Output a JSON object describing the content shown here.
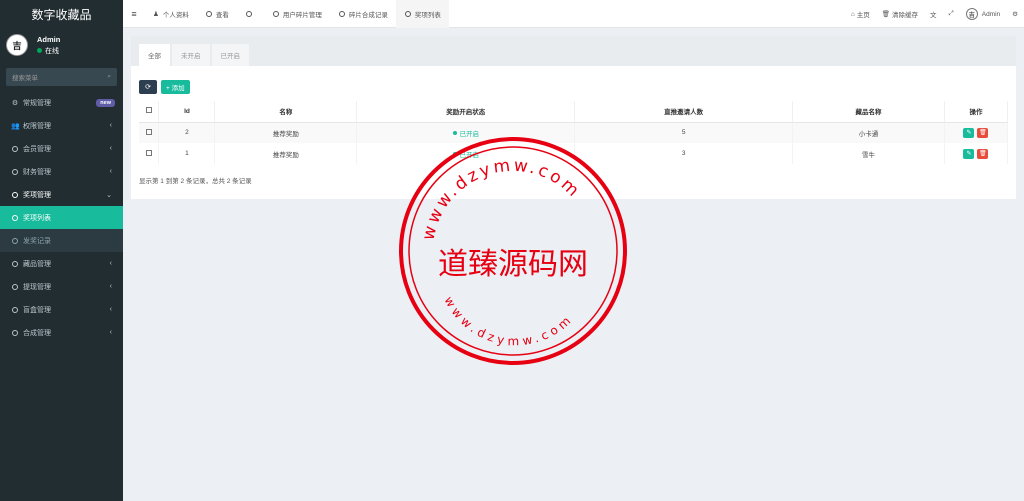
{
  "brand": "数字收藏品",
  "user": {
    "name": "Admin",
    "status": "在线",
    "avatar_glyph": "吉祥"
  },
  "search": {
    "placeholder": "搜索菜单"
  },
  "sidebar": {
    "items": [
      {
        "label": "常规管理",
        "icon": "gears-icon",
        "badge": "new"
      },
      {
        "label": "权限管理",
        "icon": "users-icon",
        "chevron": "‹"
      },
      {
        "label": "会员管理",
        "icon": "circle-icon",
        "chevron": "‹"
      },
      {
        "label": "财务管理",
        "icon": "circle-icon",
        "chevron": "‹"
      },
      {
        "label": "奖项管理",
        "icon": "circle-icon",
        "chevron": "⌄"
      },
      {
        "label": "奖项列表",
        "icon": "circle-icon"
      },
      {
        "label": "发奖记录",
        "icon": "circle-icon"
      },
      {
        "label": "藏品管理",
        "icon": "circle-icon",
        "chevron": "‹"
      },
      {
        "label": "提现管理",
        "icon": "circle-icon",
        "chevron": "‹"
      },
      {
        "label": "盲盒管理",
        "icon": "circle-icon",
        "chevron": "‹"
      },
      {
        "label": "合成管理",
        "icon": "circle-icon",
        "chevron": "‹"
      }
    ]
  },
  "topbar": {
    "tabs": [
      {
        "label": "个人资料",
        "icon": "user-icon"
      },
      {
        "label": "查看",
        "icon": "circle-icon"
      },
      {
        "label": "",
        "icon": "circle-icon"
      },
      {
        "label": "用户碎片管理",
        "icon": "circle-icon"
      },
      {
        "label": "碎片合成记录",
        "icon": "circle-icon"
      },
      {
        "label": "奖项列表",
        "icon": "circle-icon"
      }
    ],
    "home": "主页",
    "clear_cache": "清除缓存",
    "admin": "Admin"
  },
  "subtabs": [
    "全部",
    "未开启",
    "已开启"
  ],
  "toolbar": {
    "refresh_icon": "⟳",
    "add_label": "+ 添加"
  },
  "table": {
    "headers": [
      "Id",
      "名称",
      "奖励开启状态",
      "直推邀请人数",
      "藏品名称",
      "操作"
    ],
    "rows": [
      {
        "id": "2",
        "name": "推荐奖励",
        "status": "已开启",
        "invites": "5",
        "item": "小卡通"
      },
      {
        "id": "1",
        "name": "推荐奖励",
        "status": "已开启",
        "invites": "3",
        "item": "雪牛"
      }
    ]
  },
  "pager_text": "显示第 1 到第 2 条记录，总共 2 条记录",
  "watermark": {
    "center": "道臻源码网",
    "top_arc": "www.dzymw.com",
    "bottom_arc": "www.dzymw.com",
    "color": "#e60012"
  }
}
